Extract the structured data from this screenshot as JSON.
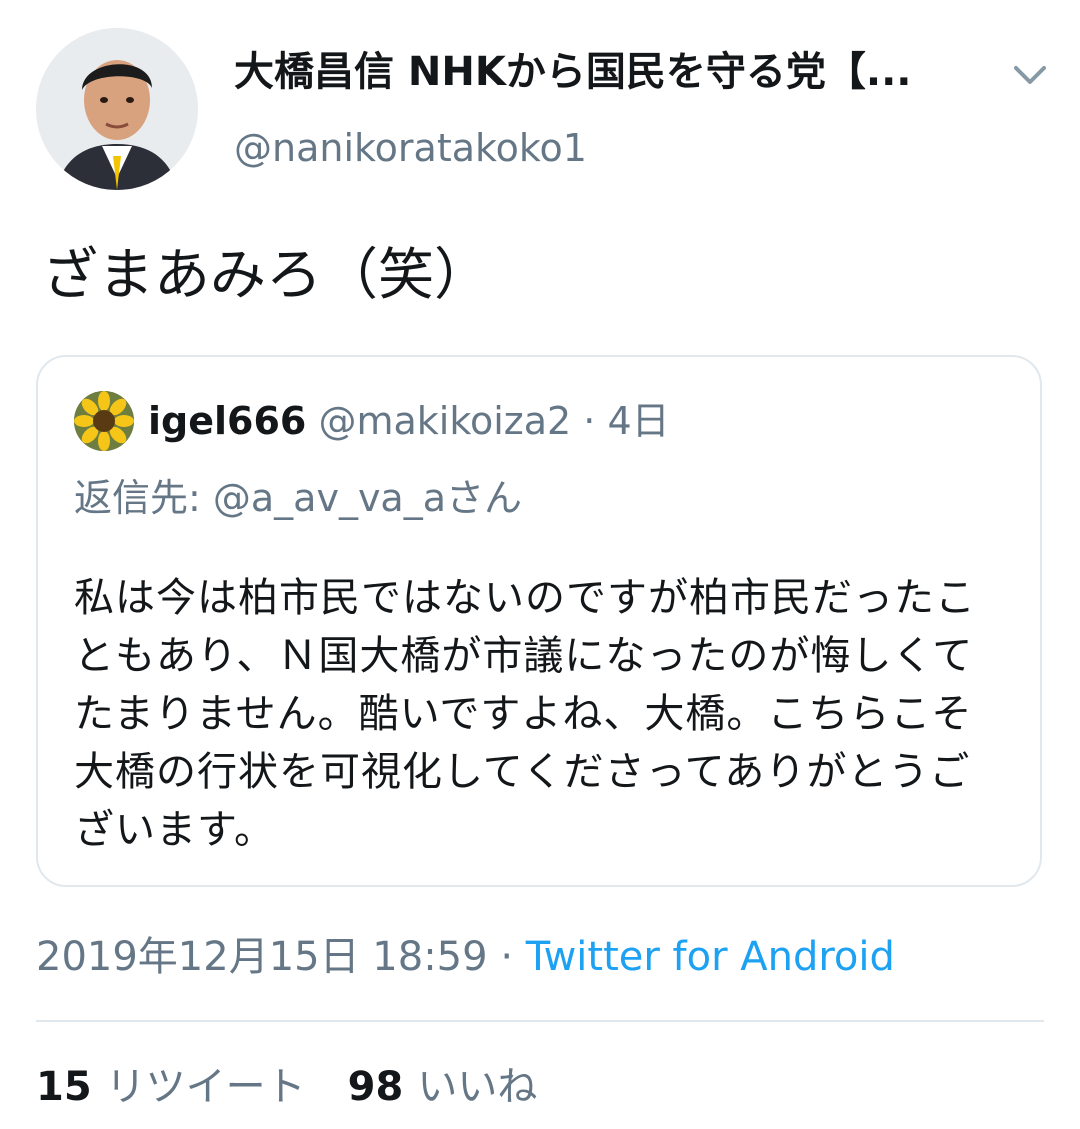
{
  "author": {
    "display_name": "大橋昌信 NHKから国民を守る党【...",
    "handle": "@nanikoratakoko1"
  },
  "tweet": {
    "text": "ざまあみろ（笑）"
  },
  "quoted_tweet": {
    "name": "igel666",
    "handle": "@makikoiza2",
    "separator": "·",
    "time": "4日",
    "reply_to": "返信先: @a_av_va_aさん",
    "body": "私は今は柏市民ではないのですが柏市民だったこともあり、Ｎ国大橋が市議になったのが悔しくてたまりません。酷いですよね、大橋。こちらこそ大橋の行状を可視化してくださってありがとうございます。"
  },
  "meta": {
    "timestamp": "2019年12月15日 18:59",
    "separator": "·",
    "source": "Twitter for Android"
  },
  "stats": {
    "retweets": "15",
    "retweets_label": "リツイート",
    "likes": "98",
    "likes_label": "いいね"
  },
  "icons": {
    "avatar": "avatar-photo",
    "caret": "chevron-down-icon",
    "quoted_avatar": "sunflower-avatar"
  },
  "colors": {
    "text": "#14171a",
    "secondary": "#657786",
    "link": "#1da1f2",
    "border": "#e1e8ed"
  }
}
